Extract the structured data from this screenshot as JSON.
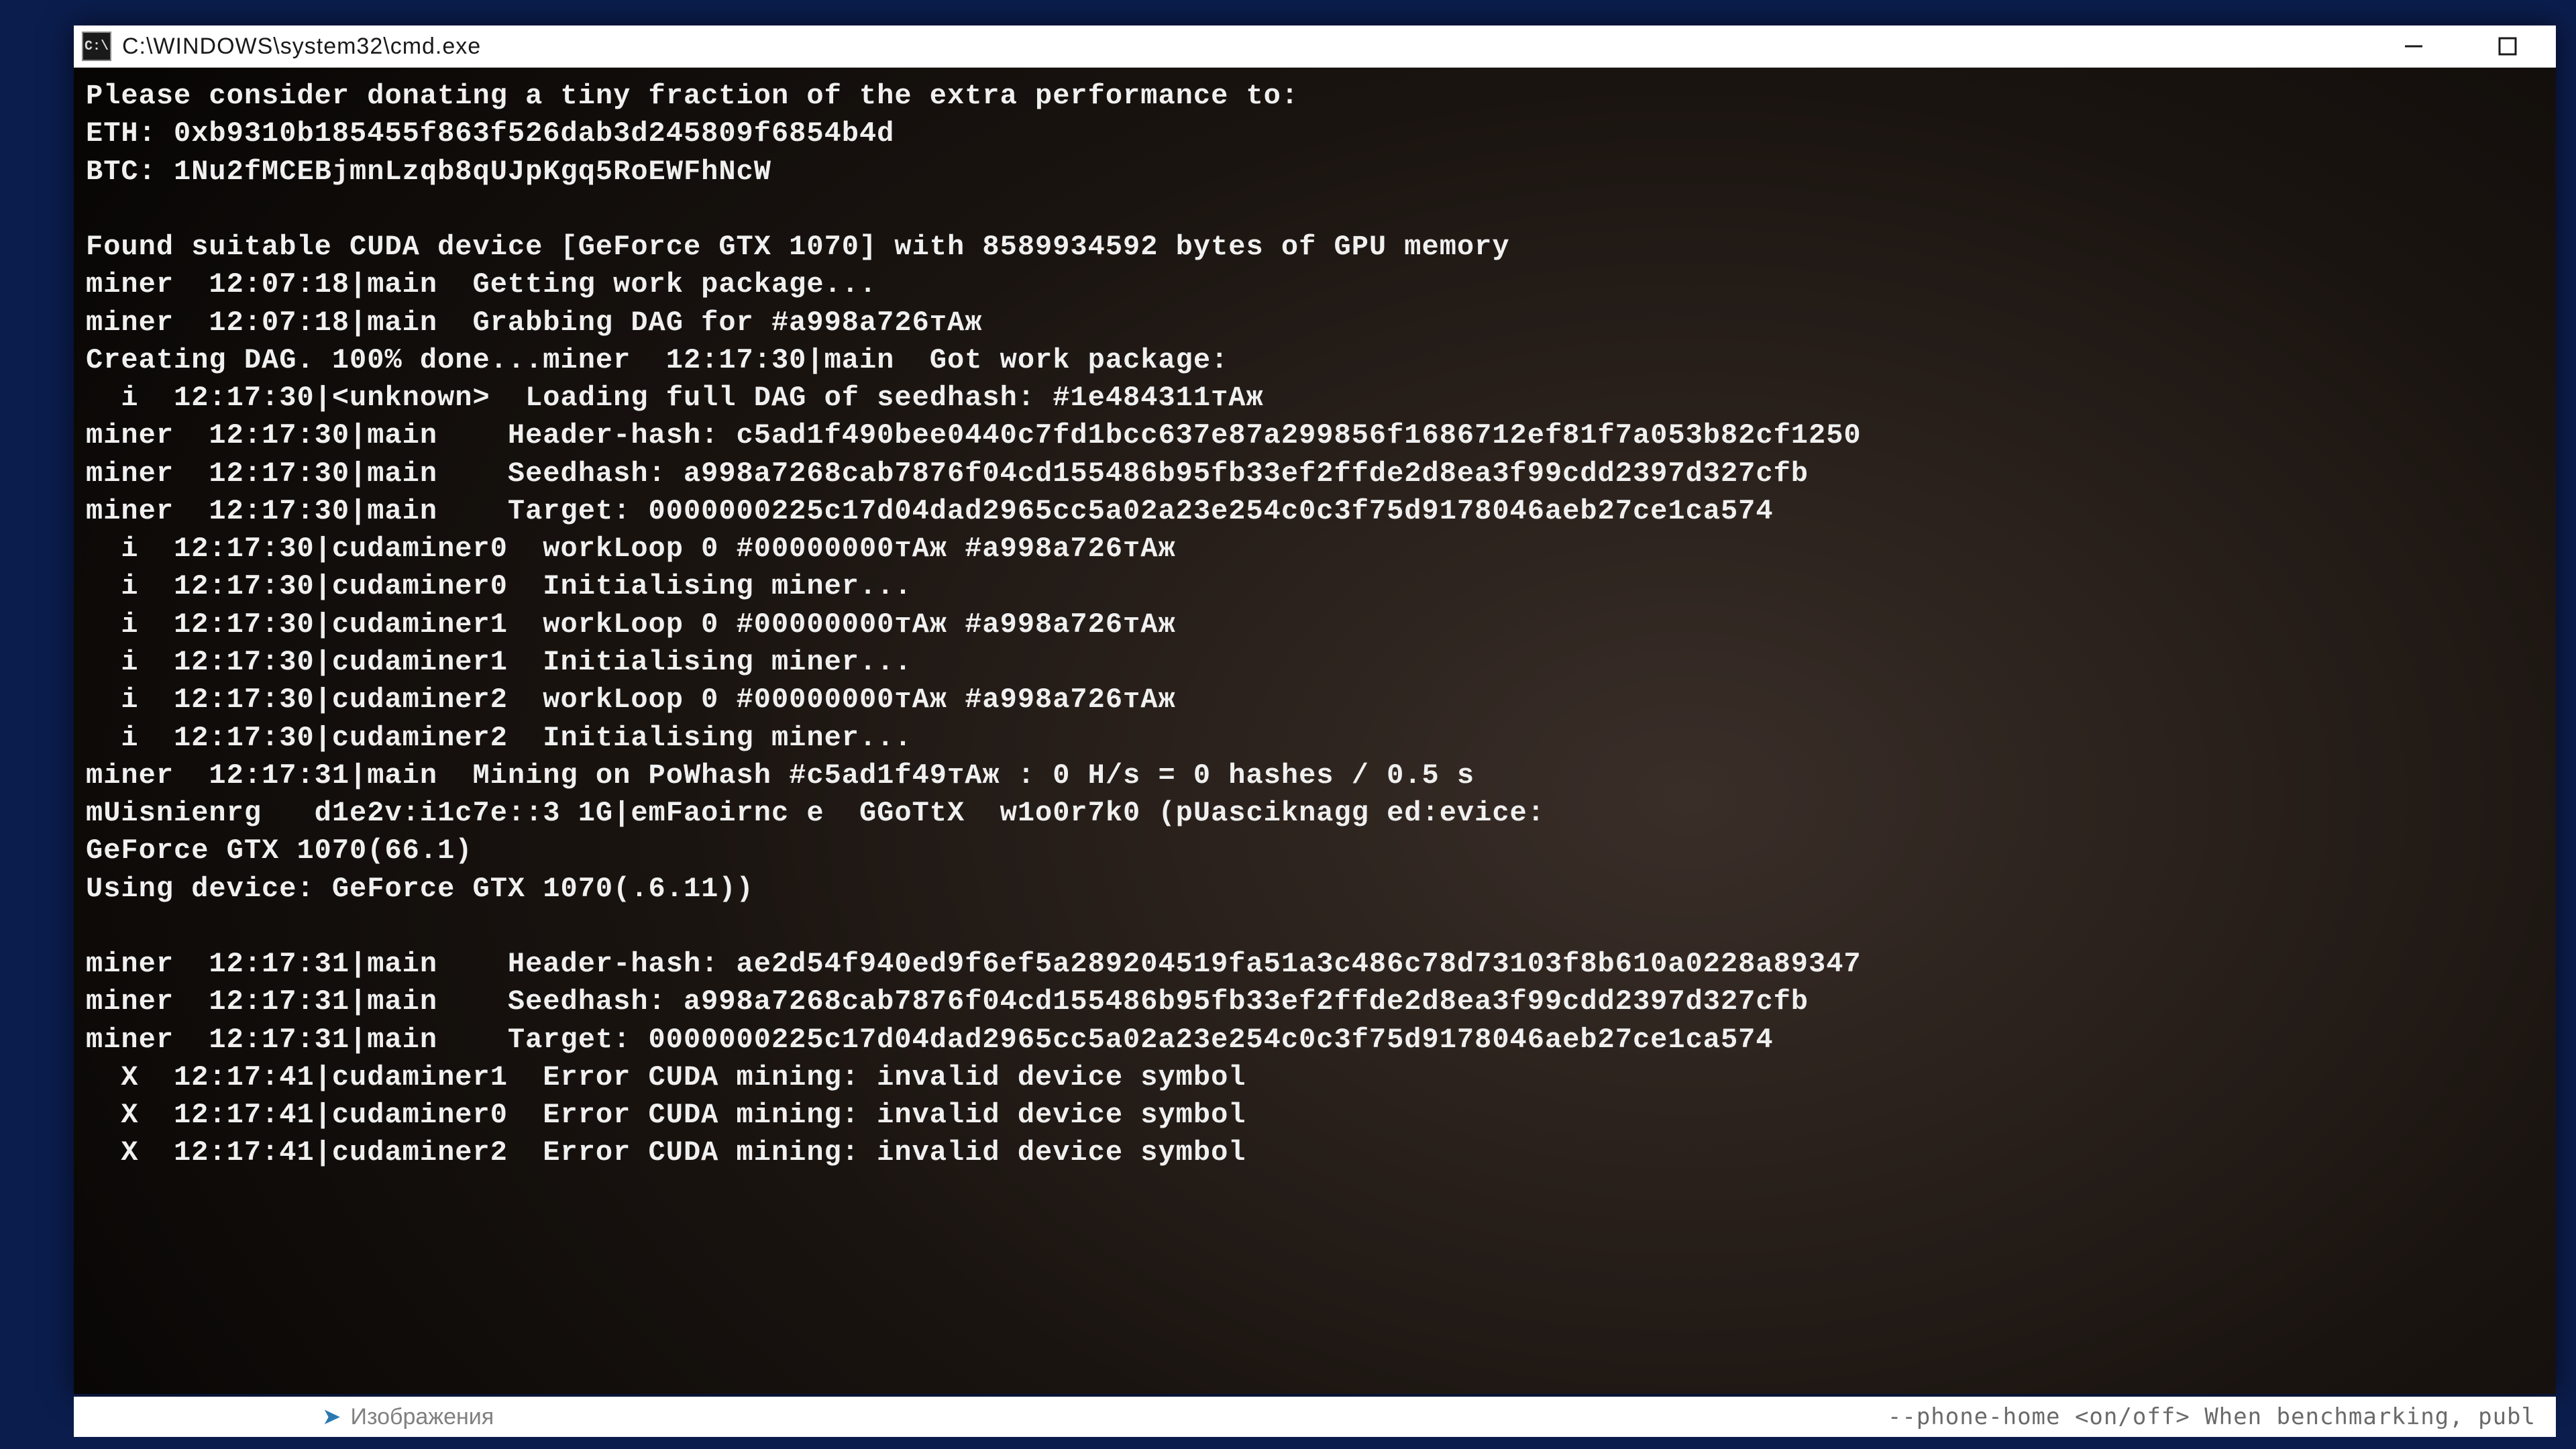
{
  "window": {
    "title": "C:\\WINDOWS\\system32\\cmd.exe",
    "icon_label": "C:\\"
  },
  "console": {
    "lines": [
      "Please consider donating a tiny fraction of the extra performance to:",
      "ETH: 0xb9310b185455f863f526dab3d245809f6854b4d",
      "BTC: 1Nu2fMCEBjmnLzqb8qUJpKgq5RoEWFhNcW",
      "",
      "Found suitable CUDA device [GeForce GTX 1070] with 8589934592 bytes of GPU memory",
      "miner  12:07:18|main  Getting work package...",
      "miner  12:07:18|main  Grabbing DAG for #a998a726тАж",
      "Creating DAG. 100% done...miner  12:17:30|main  Got work package:",
      "  i  12:17:30|<unknown>  Loading full DAG of seedhash: #1e484311тАж",
      "miner  12:17:30|main    Header-hash: c5ad1f490bee0440c7fd1bcc637e87a299856f1686712ef81f7a053b82cf1250",
      "miner  12:17:30|main    Seedhash: a998a7268cab7876f04cd155486b95fb33ef2ffde2d8ea3f99cdd2397d327cfb",
      "miner  12:17:30|main    Target: 0000000225c17d04dad2965cc5a02a23e254c0c3f75d9178046aeb27ce1ca574",
      "  i  12:17:30|cudaminer0  workLoop 0 #00000000тАж #a998a726тАж",
      "  i  12:17:30|cudaminer0  Initialising miner...",
      "  i  12:17:30|cudaminer1  workLoop 0 #00000000тАж #a998a726тАж",
      "  i  12:17:30|cudaminer1  Initialising miner...",
      "  i  12:17:30|cudaminer2  workLoop 0 #00000000тАж #a998a726тАж",
      "  i  12:17:30|cudaminer2  Initialising miner...",
      "miner  12:17:31|main  Mining on PoWhash #c5ad1f49тАж : 0 H/s = 0 hashes / 0.5 s",
      "mUisnienrg   d1e2v:i1c7e::3 1G|emFaoirnc e  GGoTtX  w1o0r7k0 (pUasciknagg ed:evice:",
      "GeForce GTX 1070(66.1)",
      "Using device: GeForce GTX 1070(.6.11))",
      "",
      "miner  12:17:31|main    Header-hash: ae2d54f940ed9f6ef5a289204519fa51a3c486c78d73103f8b610a0228a89347",
      "miner  12:17:31|main    Seedhash: a998a7268cab7876f04cd155486b95fb33ef2ffde2d8ea3f99cdd2397d327cfb",
      "miner  12:17:31|main    Target: 0000000225c17d04dad2965cc5a02a23e254c0c3f75d9178046aeb27ce1ca574",
      "  X  12:17:41|cudaminer1  Error CUDA mining: invalid device symbol",
      "  X  12:17:41|cudaminer0  Error CUDA mining: invalid device symbol",
      "  X  12:17:41|cudaminer2  Error CUDA mining: invalid device symbol"
    ]
  },
  "taskbar": {
    "left_label": "Изображения",
    "right_label": "--phone-home <on/off>  When benchmarking, publ"
  }
}
